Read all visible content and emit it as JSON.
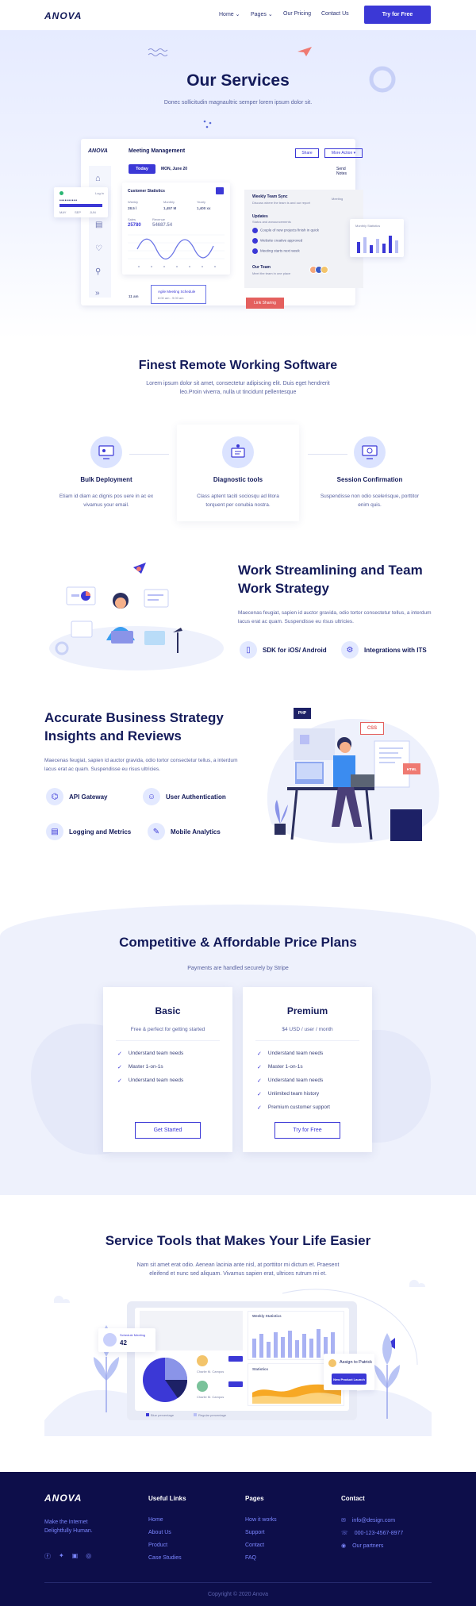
{
  "header": {
    "logo": "ANOVA",
    "nav": [
      {
        "label": "Home",
        "dropdown": true
      },
      {
        "label": "Pages",
        "dropdown": true
      },
      {
        "label": "Our Pricing",
        "dropdown": false
      },
      {
        "label": "Contact Us",
        "dropdown": false
      }
    ],
    "cta": "Try for Free"
  },
  "hero": {
    "title": "Our Services",
    "subtitle": "Donec sollicitudin magnaultric semper lorem ipsum dolor sit.",
    "dashboard": {
      "logo": "ANOVA",
      "title": "Meeting Management",
      "share": "Share",
      "more": "More Action",
      "today": "Today",
      "date": "MON, June 20",
      "send_notes": "Send Notes",
      "stats_title": "Customer Statistics",
      "stats_cols": [
        {
          "label": "Weekly",
          "value": "28.5 l"
        },
        {
          "label": "Monthly",
          "value": "1,457 M"
        },
        {
          "label": "Yearly",
          "value": "1,400 xx"
        }
      ],
      "stats_values": [
        {
          "label": "Sales",
          "value": "25780"
        },
        {
          "label": "Revenue",
          "value": "54687.54"
        }
      ],
      "weekly_sync": "Weekly Team Sync",
      "weekly_sub": "Discuss where the team is and our report",
      "weekly_badge": "Meeting",
      "updates": "Updates",
      "updates_sub": "Status and announcements",
      "update_items": [
        "Couple of new projects finish in quick",
        "Website creative approved",
        "Meeting starts next week"
      ],
      "our_team": "Our Team",
      "our_team_sub": "Meet the team in one place",
      "time": "11 am",
      "event": "Agile Meeting Schedule",
      "event_time": "8:00 am - 9:00 am",
      "link_button": "Link Sharing",
      "monthly": "Monthly Statistics",
      "mini_label": "Log in",
      "mini_row": [
        "MAY",
        "SEP",
        "JUN"
      ]
    }
  },
  "remote": {
    "title": "Finest Remote Working Software",
    "subtitle": "Lorem ipsum dolor sit amet, consectetur adipiscing elit. Duis eget hendrerit leo.Proin viverra, nulla ut tincidunt pellentesque",
    "features": [
      {
        "title": "Bulk Deployment",
        "text": "Etiam id diam ac dignis pos uere in ac ex vivamus your email.",
        "icon": "deploy-icon"
      },
      {
        "title": "Diagnostic tools",
        "text": "Class aptent taciti sociosqu ad litora torquent per conubia nostra.",
        "icon": "diagnostic-icon"
      },
      {
        "title": "Session Confirmation",
        "text": "Suspendisse non odio scelerisque, porttitor enim quis.",
        "icon": "session-icon"
      }
    ]
  },
  "streamline": {
    "title": "Work Streamlining and Team Work Strategy",
    "text": "Maecenas feugiat, sapien id auctor gravida, odio tortor consectetur tellus, a interdum lacus erat ac quam. Suspendisse eu risus ultricies.",
    "items": [
      {
        "label": "SDK for iOS/ Android",
        "icon": "mobile-icon"
      },
      {
        "label": "Integrations with ITS",
        "icon": "gear-icon"
      }
    ]
  },
  "insights": {
    "title": "Accurate Business Strategy Insights and Reviews",
    "text": "Maecenas feugiat, sapien id auctor gravida, odio tortor consectetur tellus, a interdum lacus erat ac quam. Suspendisse eu risus ultricies.",
    "items": [
      {
        "label": "API Gateway",
        "icon": "api-icon"
      },
      {
        "label": "User Authentication",
        "icon": "user-icon"
      },
      {
        "label": "Logging and Metrics",
        "icon": "metrics-icon"
      },
      {
        "label": "Mobile Analytics",
        "icon": "analytics-icon"
      }
    ],
    "tags": {
      "php": "PHP",
      "css": "CSS",
      "html": "HTML"
    }
  },
  "pricing": {
    "title": "Competitive & Affordable Price Plans",
    "subtitle": "Payments are handled securely by Stripe",
    "plans": [
      {
        "name": "Basic",
        "price": "Free & perfect for getting started",
        "features": [
          "Understand team needs",
          "Master 1-on-1s",
          "Understand team needs"
        ],
        "button": "Get Started"
      },
      {
        "name": "Premium",
        "price": "$4 USD / user / month",
        "features": [
          "Understand team needs",
          "Master 1-on-1s",
          "Understand team needs",
          "Unlimited team history",
          "Premium customer support"
        ],
        "button": "Try for Free"
      }
    ]
  },
  "tools": {
    "title": "Service Tools that Makes Your Life Easier",
    "text": "Nam sit amet erat odio. Aenean lacinia ante nisl, at porttitor mi dictum et. Praesent eleifend et nunc sed aliquam. Vivamus sapien erat, ultrices rutrum mi et.",
    "weekly": "Weekly Statistics",
    "statistics": "Statistics",
    "schedule": "Schedule Meeting",
    "schedule_count": "42",
    "assign": "Assign to Patrick",
    "assign_btn": "New Product Launch",
    "person1": "Charlie M. Campos",
    "person2": "Charlie M. Campos",
    "legend1": "Blue percentage",
    "legend2": "Regular percentage"
  },
  "footer": {
    "logo": "ANOVA",
    "tagline": "Make the Internet Delightfully Human.",
    "useful_title": "Useful Links",
    "useful": [
      "Home",
      "About Us",
      "Product",
      "Case Studies"
    ],
    "pages_title": "Pages",
    "pages": [
      "How it works",
      "Support",
      "Contact",
      "FAQ"
    ],
    "contact_title": "Contact",
    "contact": [
      {
        "icon": "mail-icon",
        "text": "info@design.com"
      },
      {
        "icon": "phone-icon",
        "text": "000-123-4567-8977"
      },
      {
        "icon": "eye-icon",
        "text": "Our partners"
      }
    ],
    "social": [
      "facebook-icon",
      "twitter-icon",
      "linkedin-icon",
      "instagram-icon"
    ],
    "copyright": "Copyright © 2020 Anova"
  },
  "colors": {
    "primary": "#3b38d6",
    "navy": "#141b5a",
    "footer": "#0d0e4a",
    "accent": "#e4605e"
  }
}
